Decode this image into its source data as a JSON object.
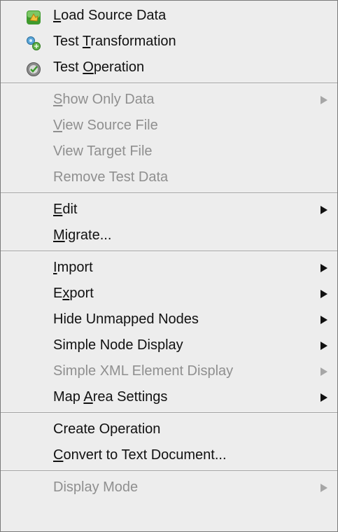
{
  "menu": {
    "items": [
      {
        "id": "load-source-data",
        "label": "Load Source Data",
        "mnemonic": 0,
        "icon": "load-data-icon",
        "enabled": true,
        "submenu": false
      },
      {
        "id": "test-transformation",
        "label": "Test Transformation",
        "mnemonic": 5,
        "icon": "test-transformation-icon",
        "enabled": true,
        "submenu": false
      },
      {
        "id": "test-operation",
        "label": "Test Operation",
        "mnemonic": 5,
        "icon": "test-operation-icon",
        "enabled": true,
        "submenu": false
      },
      {
        "separator": true
      },
      {
        "id": "show-only-data",
        "label": "Show Only Data",
        "mnemonic": 0,
        "enabled": false,
        "submenu": true
      },
      {
        "id": "view-source-file",
        "label": "View Source File",
        "mnemonic": 0,
        "enabled": false,
        "submenu": false
      },
      {
        "id": "view-target-file",
        "label": "View Target File",
        "mnemonic": -1,
        "enabled": false,
        "submenu": false
      },
      {
        "id": "remove-test-data",
        "label": "Remove Test Data",
        "mnemonic": -1,
        "enabled": false,
        "submenu": false
      },
      {
        "separator": true
      },
      {
        "id": "edit",
        "label": "Edit",
        "mnemonic": 0,
        "enabled": true,
        "submenu": true
      },
      {
        "id": "migrate",
        "label": "Migrate...",
        "mnemonic": 0,
        "enabled": true,
        "submenu": false
      },
      {
        "separator": true
      },
      {
        "id": "import",
        "label": "Import",
        "mnemonic": 0,
        "enabled": true,
        "submenu": true
      },
      {
        "id": "export",
        "label": "Export",
        "mnemonic": 1,
        "enabled": true,
        "submenu": true
      },
      {
        "id": "hide-unmapped-nodes",
        "label": "Hide Unmapped Nodes",
        "mnemonic": -1,
        "enabled": true,
        "submenu": true
      },
      {
        "id": "simple-node-display",
        "label": "Simple Node Display",
        "mnemonic": -1,
        "enabled": true,
        "submenu": true
      },
      {
        "id": "simple-xml-element-display",
        "label": "Simple XML Element Display",
        "mnemonic": -1,
        "enabled": false,
        "submenu": true
      },
      {
        "id": "map-area-settings",
        "label": "Map Area Settings",
        "mnemonic": 4,
        "enabled": true,
        "submenu": true
      },
      {
        "separator": true
      },
      {
        "id": "create-operation",
        "label": "Create Operation",
        "mnemonic": -1,
        "enabled": true,
        "submenu": false
      },
      {
        "id": "convert-to-text-document",
        "label": "Convert to Text Document...",
        "mnemonic": 0,
        "enabled": true,
        "submenu": false
      },
      {
        "separator": true
      },
      {
        "id": "display-mode",
        "label": "Display Mode",
        "mnemonic": -1,
        "enabled": false,
        "submenu": true
      }
    ]
  }
}
